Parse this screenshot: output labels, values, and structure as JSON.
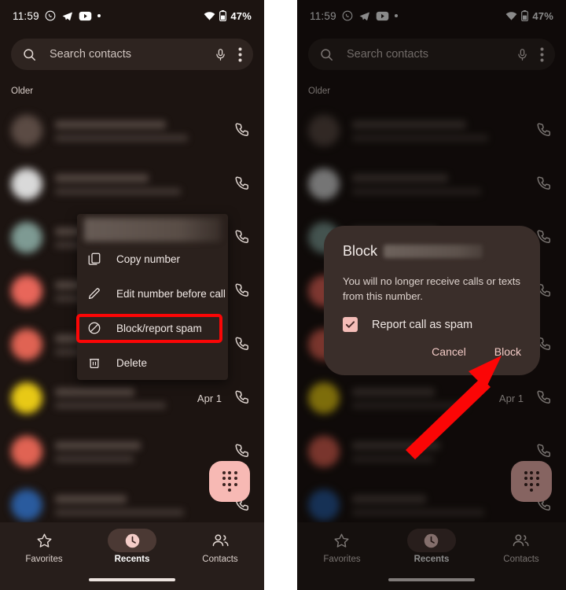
{
  "statusbar": {
    "time": "11:59",
    "icons": [
      "whatsapp-icon",
      "telegram-icon",
      "youtube-icon",
      "dot-icon"
    ],
    "wifi": "wifi-icon",
    "battery": "battery-icon",
    "battery_text": "47%"
  },
  "search": {
    "placeholder": "Search contacts",
    "search_icon": "search-icon",
    "mic_icon": "microphone-icon",
    "overflow_icon": "more-vert-icon"
  },
  "list": {
    "section_label": "Older",
    "rows": [
      {
        "avatar_color": "#5b4b44",
        "date": "",
        "redacted": true
      },
      {
        "avatar_color": "#d9d9d9",
        "date": "",
        "redacted": true
      },
      {
        "avatar_color": "#7e9a93",
        "date": "",
        "redacted": true
      },
      {
        "avatar_color": "#e8665a",
        "date": "",
        "redacted": true
      },
      {
        "avatar_color": "#e06353",
        "date": "",
        "redacted": true
      },
      {
        "avatar_color": "#e8c916",
        "date": "Apr 1",
        "redacted": true
      },
      {
        "avatar_color": "#e06353",
        "date": "",
        "redacted": true
      },
      {
        "avatar_color": "#2a5b9e",
        "date": "",
        "redacted": true
      }
    ]
  },
  "fab": {
    "name": "dialpad-fab",
    "color": "#f7b9b4"
  },
  "bottomnav": {
    "items": [
      {
        "label": "Favorites",
        "icon": "star-icon",
        "active": false
      },
      {
        "label": "Recents",
        "icon": "clock-icon",
        "active": true
      },
      {
        "label": "Contacts",
        "icon": "contacts-icon",
        "active": false
      }
    ]
  },
  "context_menu": {
    "items": [
      {
        "label": "Copy number",
        "icon": "copy-icon"
      },
      {
        "label": "Edit number before call",
        "icon": "pencil-icon"
      },
      {
        "label": "Block/report spam",
        "icon": "block-icon",
        "highlighted": true
      },
      {
        "label": "Delete",
        "icon": "trash-icon"
      }
    ],
    "highlight_color": "#fb0606"
  },
  "dialog": {
    "title": "Block",
    "body": "You will no longer receive calls or texts from this number.",
    "checkbox_label": "Report call as spam",
    "checkbox_checked": true,
    "checkbox_color": "#f5bdb8",
    "cancel_label": "Cancel",
    "confirm_label": "Block"
  },
  "annotation": {
    "arrow_color": "#fb0606",
    "arrow_name": "pointer-arrow"
  }
}
